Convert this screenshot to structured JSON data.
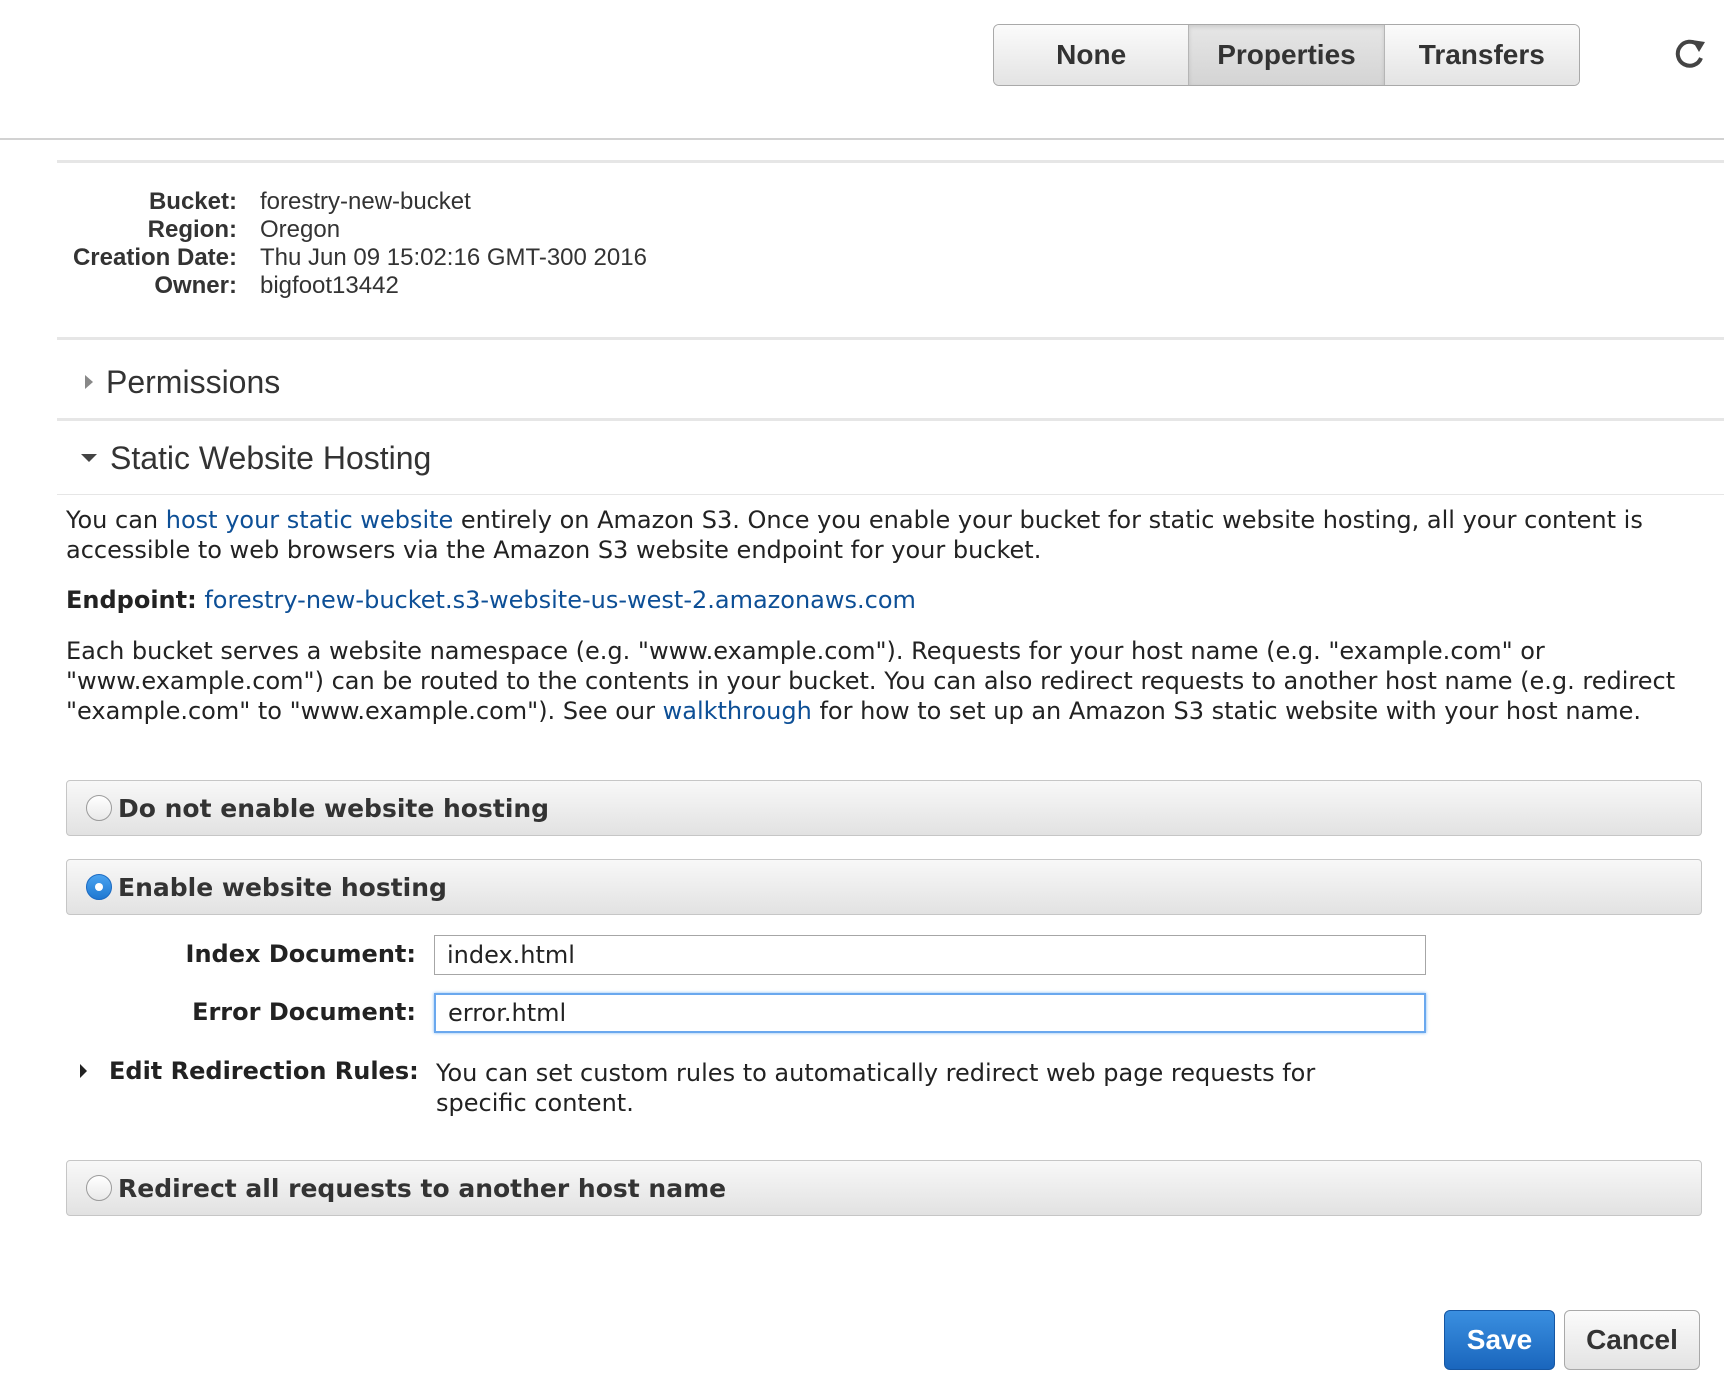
{
  "toolbar": {
    "tabs": [
      {
        "label": "None"
      },
      {
        "label": "Properties"
      },
      {
        "label": "Transfers"
      }
    ],
    "active_tab": "Properties",
    "refresh_icon": "refresh-icon"
  },
  "bucket_info": {
    "bucket_label": "Bucket:",
    "bucket_value": "forestry-new-bucket",
    "region_label": "Region:",
    "region_value": "Oregon",
    "creation_label": "Creation Date:",
    "creation_value": "Thu Jun 09 15:02:16 GMT-300 2016",
    "owner_label": "Owner:",
    "owner_value": "bigfoot13442"
  },
  "sections": {
    "permissions": "Permissions",
    "hosting": "Static Website Hosting"
  },
  "hosting": {
    "intro_pre": "You can ",
    "intro_link": "host your static website",
    "intro_post": " entirely on Amazon S3. Once you enable your bucket for static website hosting, all your content is accessible to web browsers via the Amazon S3 website endpoint for your bucket.",
    "endpoint_label": "Endpoint:",
    "endpoint_value": "forestry-new-bucket.s3-website-us-west-2.amazonaws.com",
    "namespace_pre": "Each bucket serves a website namespace (e.g. \"www.example.com\"). Requests for your host name (e.g. \"example.com\" or \"www.example.com\") can be routed to the contents in your bucket. You can also redirect requests to another host name (e.g. redirect \"example.com\" to \"www.example.com\"). See our ",
    "namespace_link": "walkthrough",
    "namespace_post": " for how to set up an Amazon S3 static website with your host name.",
    "options": {
      "disable": "Do not enable website hosting",
      "enable": "Enable website hosting",
      "redirect": "Redirect all requests to another host name"
    },
    "selected_option": "enable",
    "index_label": "Index Document:",
    "index_value": "index.html",
    "error_label": "Error Document:",
    "error_value": "error.html",
    "redirect_rules_label": "Edit Redirection Rules:",
    "redirect_rules_desc": "You can set custom rules to automatically redirect web page requests for specific content."
  },
  "actions": {
    "save": "Save",
    "cancel": "Cancel"
  },
  "colors": {
    "link": "#0d4f96",
    "primary": "#1f78d1"
  }
}
